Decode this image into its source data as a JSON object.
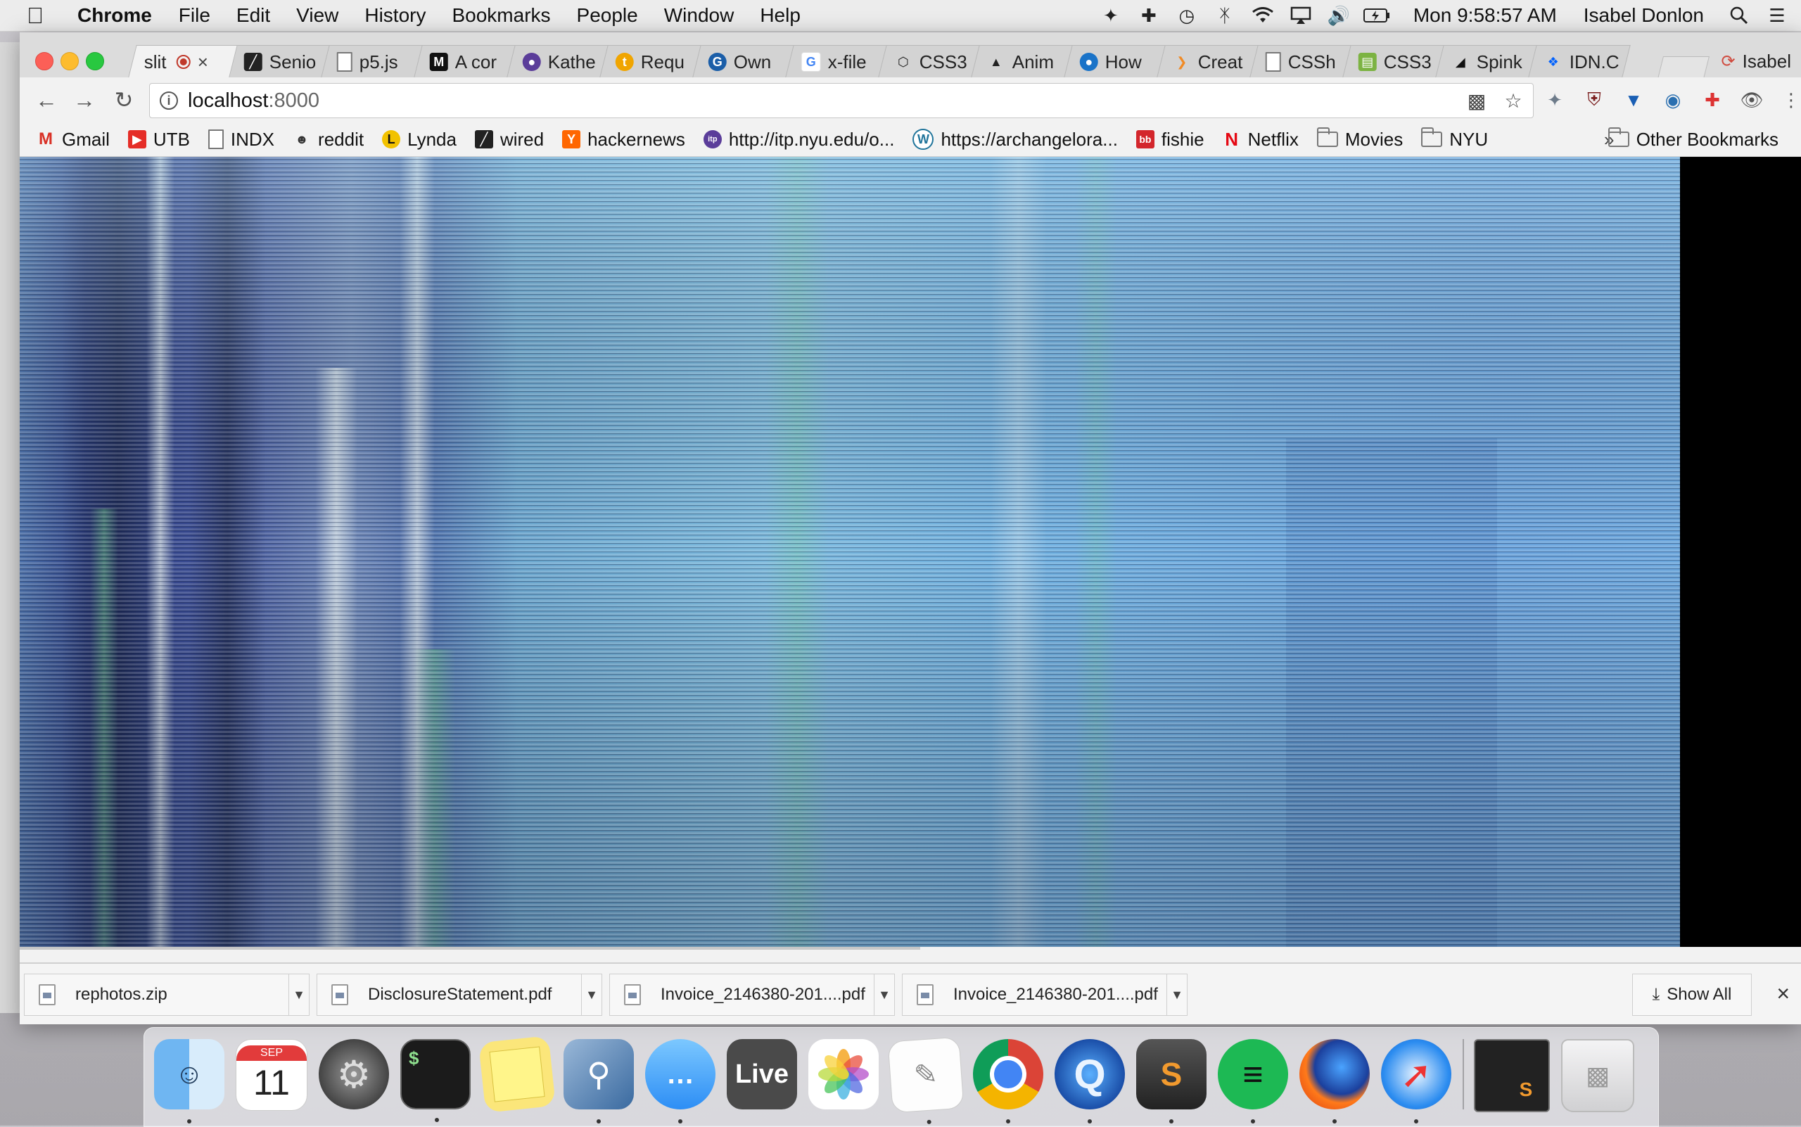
{
  "menubar": {
    "app_name": "Chrome",
    "menus": [
      "File",
      "Edit",
      "View",
      "History",
      "Bookmarks",
      "People",
      "Window",
      "Help"
    ],
    "clock": "Mon 9:58:57 AM",
    "user": "Isabel Donlon"
  },
  "tabs": [
    {
      "label": "slit",
      "active": true
    },
    {
      "label": "Senio"
    },
    {
      "label": "p5.js"
    },
    {
      "label": "A cor"
    },
    {
      "label": "Kathe"
    },
    {
      "label": "Requ"
    },
    {
      "label": "Own"
    },
    {
      "label": "x-file"
    },
    {
      "label": "CSS3"
    },
    {
      "label": "Anim"
    },
    {
      "label": "How"
    },
    {
      "label": "Creat"
    },
    {
      "label": "CSSh"
    },
    {
      "label": "CSS3"
    },
    {
      "label": "Spink"
    },
    {
      "label": "IDN.C"
    }
  ],
  "profile": {
    "name": "Isabel"
  },
  "omnibox": {
    "host": "localhost",
    "port": ":8000"
  },
  "bookmarks": [
    {
      "label": "Gmail"
    },
    {
      "label": "UTB"
    },
    {
      "label": "INDX"
    },
    {
      "label": "reddit"
    },
    {
      "label": "Lynda"
    },
    {
      "label": "wired"
    },
    {
      "label": "hackernews"
    },
    {
      "label": "http://itp.nyu.edu/o..."
    },
    {
      "label": "https://archangelora..."
    },
    {
      "label": "fishie"
    },
    {
      "label": "Netflix"
    },
    {
      "label": "Movies"
    },
    {
      "label": "NYU"
    }
  ],
  "bookmarks_more": "»",
  "other_bookmarks": "Other Bookmarks",
  "downloads": [
    {
      "name": "rephotos.zip"
    },
    {
      "name": "DisclosureStatement.pdf"
    },
    {
      "name": "Invoice_2146380-201....pdf"
    },
    {
      "name": "Invoice_2146380-201....pdf"
    }
  ],
  "show_all": "Show All",
  "dock": {
    "calendar_month": "SEP",
    "calendar_day": "11",
    "terminal_prompt": "$",
    "live_label": "Live",
    "sublime_letter": "S"
  }
}
